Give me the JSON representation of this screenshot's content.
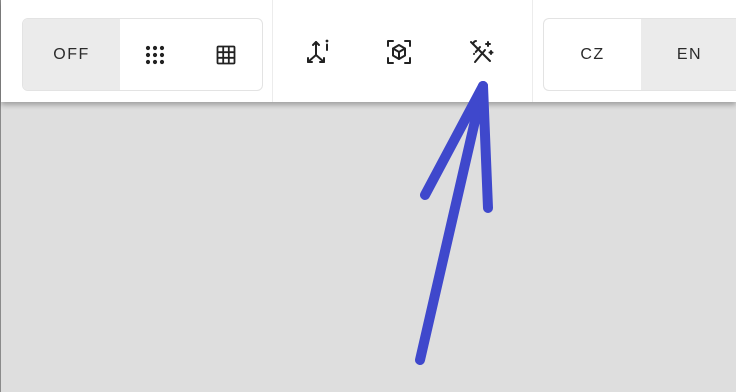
{
  "view_mode": {
    "off_label": "OFF",
    "options": [
      {
        "icon": "dots-grid-icon",
        "label": ""
      },
      {
        "icon": "table-grid-icon",
        "label": ""
      }
    ],
    "selected": "OFF"
  },
  "tools": [
    {
      "icon": "axes-info-icon"
    },
    {
      "icon": "cube-focus-icon"
    },
    {
      "icon": "magic-wand-off-icon"
    }
  ],
  "language": {
    "options": [
      "CZ",
      "EN"
    ],
    "selected": "EN"
  },
  "colors": {
    "toolbar_background": "#ffffff",
    "active_segment": "#ebebeb",
    "canvas_background": "#dedede",
    "annotation_arrow": "#3f48cc"
  }
}
